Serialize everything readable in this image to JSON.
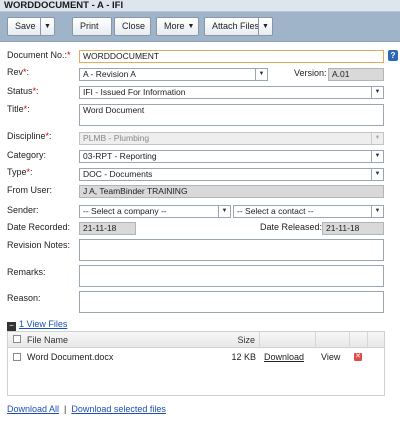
{
  "window": {
    "title": "WORDDOCUMENT - A - IFI"
  },
  "toolbar": {
    "save": "Save",
    "print": "Print",
    "close": "Close",
    "more": "More",
    "attach": "Attach Files",
    "arrow": "▼"
  },
  "form": {
    "document_no": {
      "label": "Document No.:",
      "value": "WORDDOCUMENT"
    },
    "rev": {
      "label": "Rev",
      "value": "A - Revision A"
    },
    "version": {
      "label": "Version:",
      "value": "A.01"
    },
    "status": {
      "label": "Status",
      "value": "IFI - Issued For Information"
    },
    "title": {
      "label": "Title",
      "value": "Word Document"
    },
    "discipline": {
      "label": "Discipline",
      "value": "PLMB - Plumbing"
    },
    "category": {
      "label": "Category:",
      "value": "03-RPT - Reporting"
    },
    "type": {
      "label": "Type",
      "value": "DOC - Documents"
    },
    "from_user": {
      "label": "From User:",
      "value": "J A, TeamBinder TRAINING"
    },
    "sender": {
      "label": "Sender:",
      "company_value": "-- Select a company --",
      "contact_value": "-- Select a contact --"
    },
    "date_recorded": {
      "label": "Date Recorded:",
      "value": "21-11-18"
    },
    "date_released": {
      "label": "Date Released:",
      "value": "21-11-18"
    },
    "revision_notes": {
      "label": "Revision Notes:",
      "value": ""
    },
    "remarks": {
      "label": "Remarks:",
      "value": ""
    },
    "reason": {
      "label": "Reason:",
      "value": ""
    },
    "required_mark": "*",
    "colon": ":"
  },
  "files": {
    "toggle": "−",
    "header_link": "1 View Files",
    "columns": {
      "name": "File Name",
      "size": "Size"
    },
    "rows": [
      {
        "name": "Word Document.docx",
        "size": "12 KB",
        "download": "Download",
        "view": "View",
        "delete": "✕"
      }
    ]
  },
  "footer": {
    "download_all": "Download All",
    "separator": "|",
    "download_selected": "Download selected files"
  },
  "icons": {
    "help": "?"
  }
}
